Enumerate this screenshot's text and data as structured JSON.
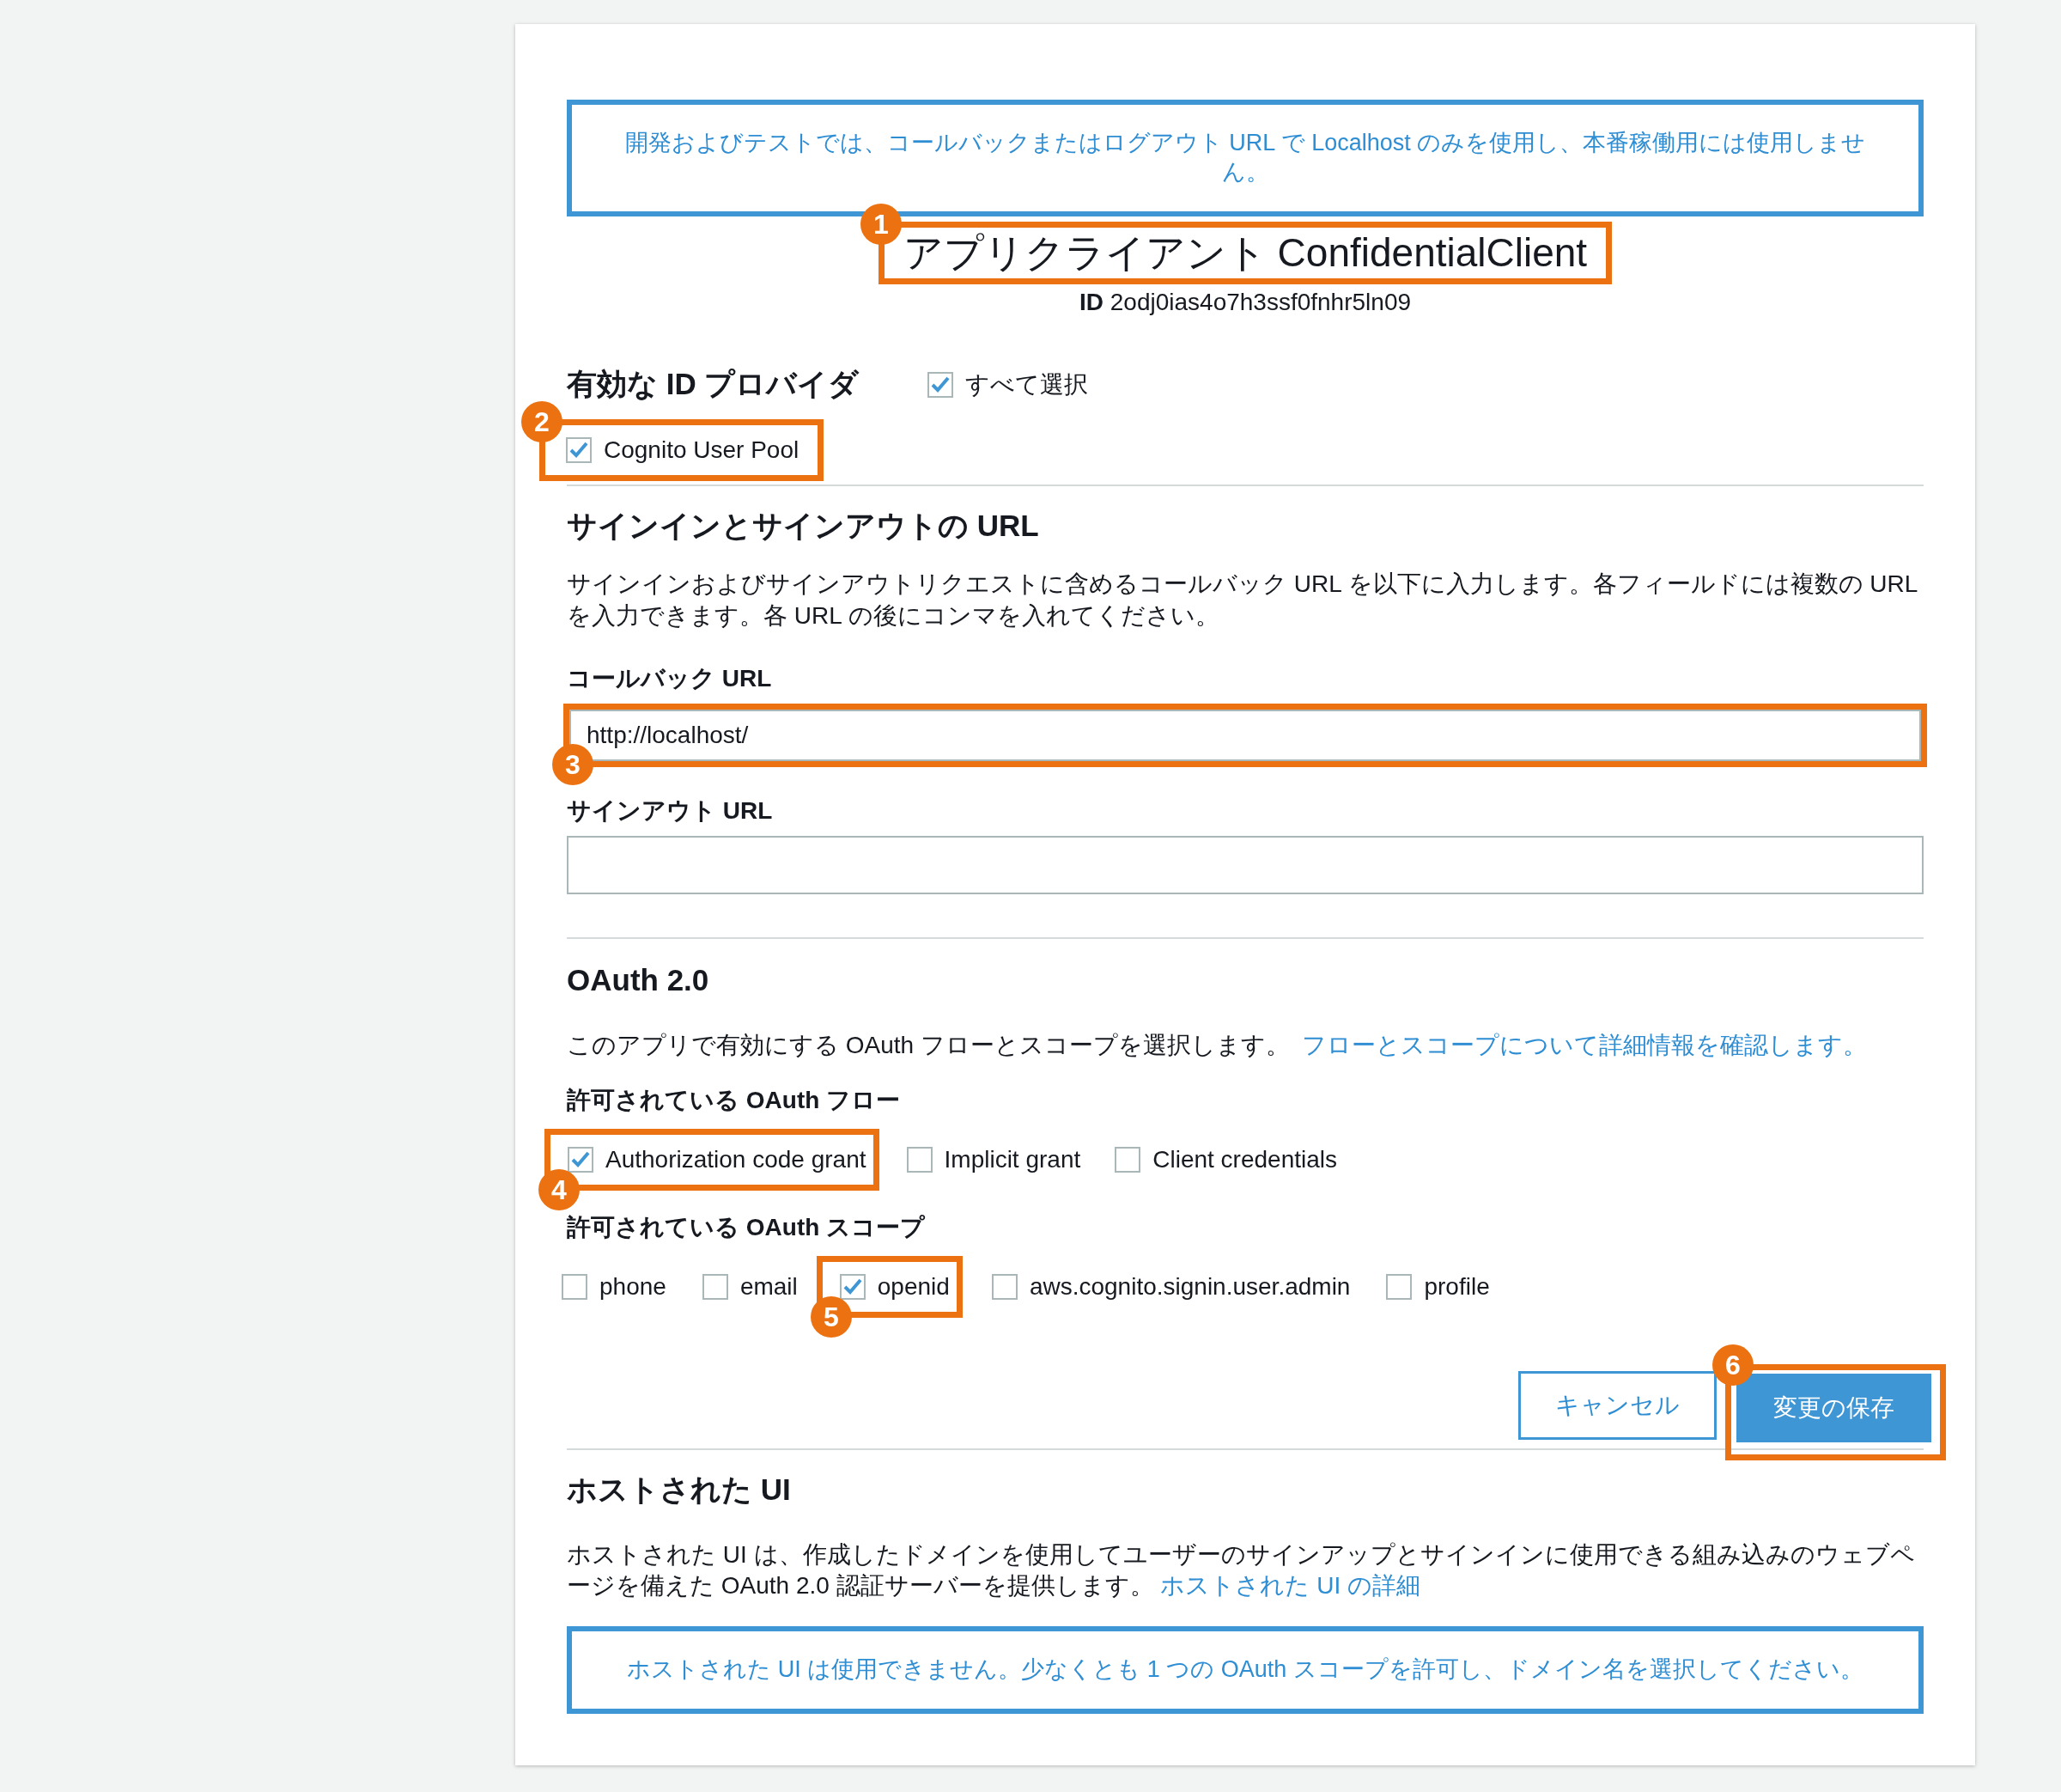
{
  "notice": "開発およびテストでは、コールバックまたはログアウト URL で Localhost のみを使用し、本番稼働用には使用しません。",
  "client": {
    "title": "アプリクライアント ConfidentialClient",
    "callout": "1",
    "id_label": "ID",
    "id_value": "2odj0ias4o7h3ssf0fnhr5ln09"
  },
  "providers": {
    "heading": "有効な ID プロバイダ",
    "select_all": {
      "label": "すべて選択",
      "checked": true
    },
    "items": [
      {
        "label": "Cognito User Pool",
        "checked": true,
        "callout": "2"
      }
    ]
  },
  "urls": {
    "heading": "サインインとサインアウトの URL",
    "description": "サインインおよびサインアウトリクエストに含めるコールバック URL を以下に入力します。各フィールドには複数の URL を入力できます。各 URL の後にコンマを入れてください。",
    "fields": [
      {
        "label": "コールバック URL",
        "value": "http://localhost/",
        "callout": "3"
      },
      {
        "label": "サインアウト URL"
      }
    ]
  },
  "oauth": {
    "heading": "OAuth 2.0",
    "description": "このアプリで有効にする OAuth フローとスコープを選択します。",
    "link": "フローとスコープについて詳細情報を確認します。",
    "flows": {
      "label": "許可されている OAuth フロー",
      "options": [
        {
          "label": "Authorization code grant",
          "checked": true,
          "callout": "4"
        },
        {
          "label": "Implicit grant",
          "checked": false
        },
        {
          "label": "Client credentials",
          "checked": false
        }
      ]
    },
    "scopes": {
      "label": "許可されている OAuth スコープ",
      "options": [
        {
          "label": "phone",
          "checked": false
        },
        {
          "label": "email",
          "checked": false
        },
        {
          "label": "openid",
          "checked": true,
          "callout": "5"
        },
        {
          "label": "aws.cognito.signin.user.admin",
          "checked": false
        },
        {
          "label": "profile",
          "checked": false
        }
      ]
    }
  },
  "buttons": [
    {
      "label": "キャンセル",
      "kind": "secondary"
    },
    {
      "label": "変更の保存",
      "kind": "primary",
      "callout": "6"
    }
  ],
  "hosted_ui": {
    "heading": "ホストされた UI",
    "description": "ホストされた UI は、作成したドメインを使用してユーザーのサインアップとサインインに使用できる組み込みのウェブページを備えた OAuth 2.0 認証サーバーを提供します。",
    "link": "ホストされた UI の詳細",
    "notice": "ホストされた UI は使用できません。少なくとも 1 つの OAuth スコープを許可し、ドメイン名を選択してください。"
  }
}
